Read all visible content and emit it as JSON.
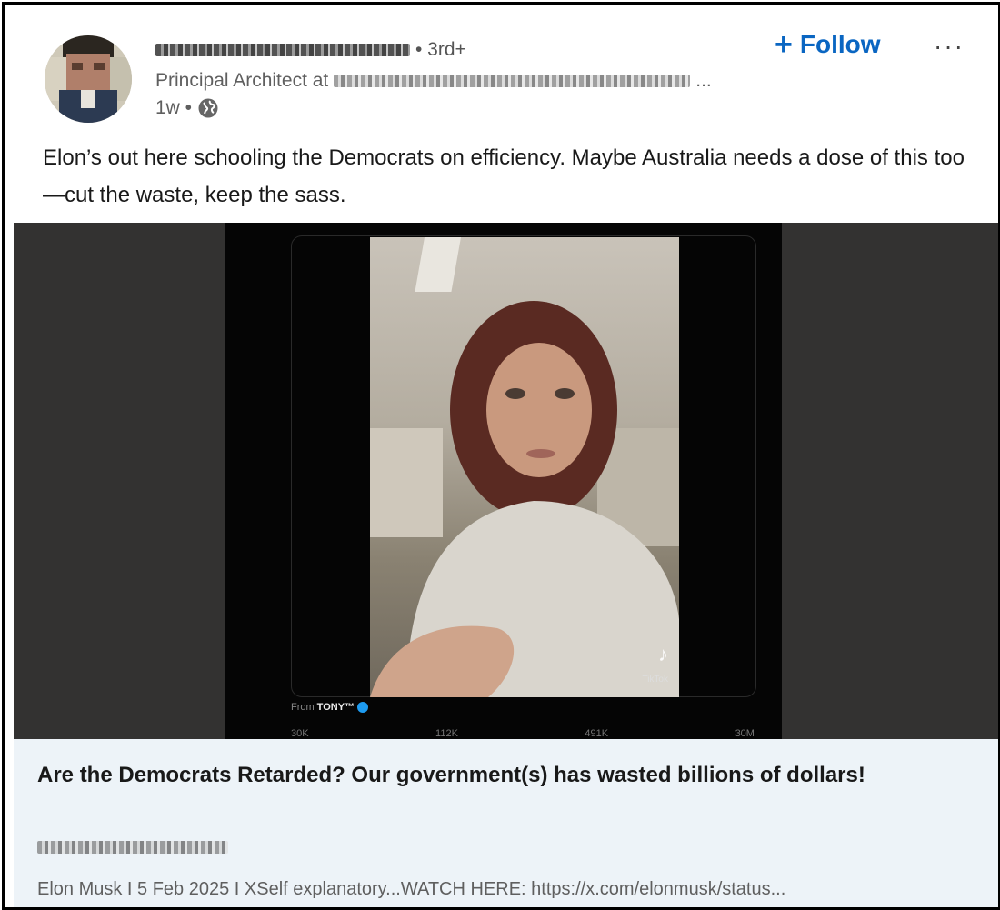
{
  "author": {
    "degree": "• 3rd+",
    "headline_prefix": "Principal Architect at",
    "headline_suffix": "...",
    "time": "1w •",
    "globe_icon": "globe-icon"
  },
  "actions": {
    "follow_plus": "+",
    "follow_label": "Follow",
    "more_label": "···"
  },
  "post": {
    "text": "Elon’s out here schooling the Democrats on efficiency. Maybe Australia needs a dose of this too—cut the waste, keep the sass."
  },
  "media": {
    "from_prefix": "From",
    "from_name": "TONY™",
    "tiktok_label": "TikTok",
    "stats": [
      "30K",
      "112K",
      "491K",
      "30M"
    ]
  },
  "link_card": {
    "title": "Are the Democrats Retarded? Our government(s) has wasted billions of dollars!",
    "description": "Elon Musk I 5 Feb 2025 I XSelf explanatory...WATCH HERE: https://x.com/elonmusk/status..."
  },
  "colors": {
    "accent": "#0a66c2",
    "link_card_bg": "#edf3f8",
    "media_bg": "#333231"
  }
}
